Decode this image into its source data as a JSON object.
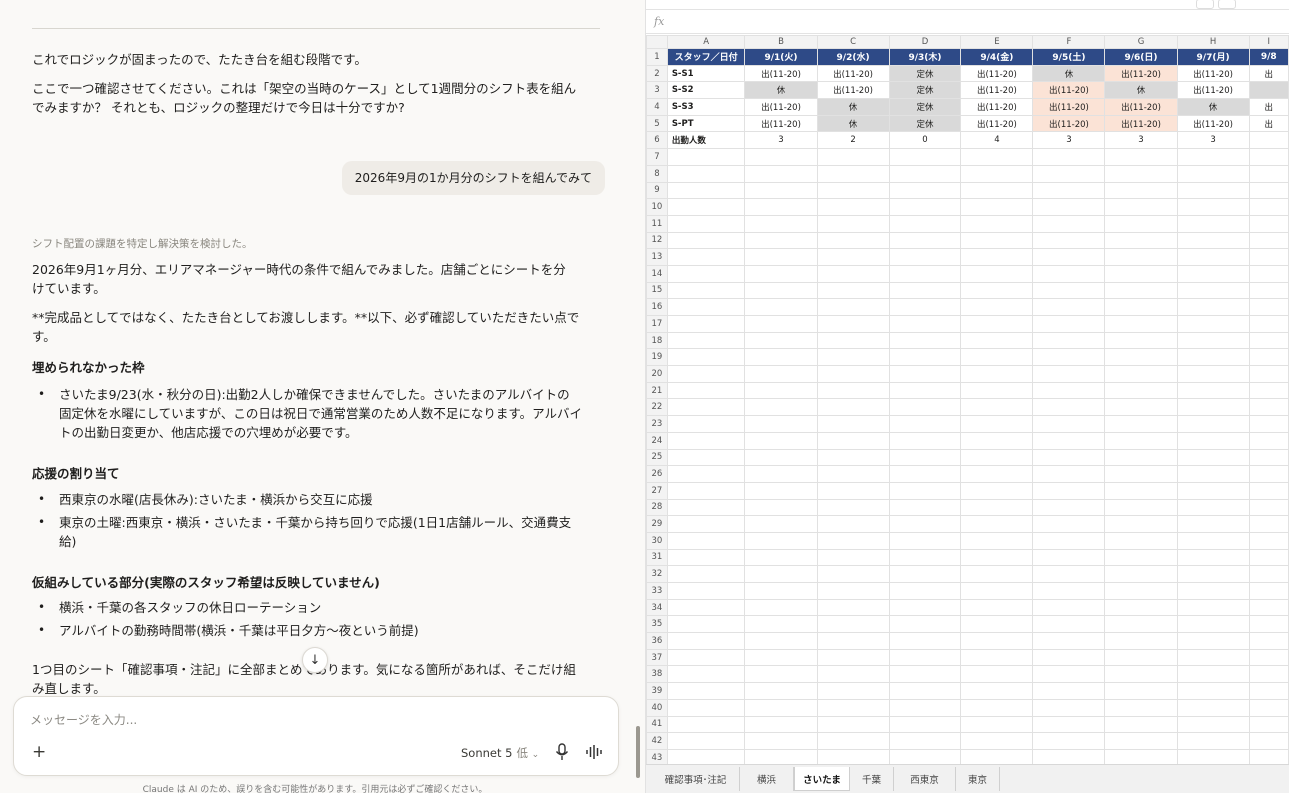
{
  "chat": {
    "assistant_intro_1": "これでロジックが固まったので、たたき台を組む段階です。",
    "assistant_intro_2": "ここで一つ確認させてください。これは「架空の当時のケース」として1週間分のシフト表を組んでみますか？ それとも、ロジックの整理だけで今日は十分ですか?",
    "user_message": "2026年9月の1か月分のシフトを組んでみて",
    "thinking_label": "シフト配置の課題を特定し解決策を検討した。",
    "para_1": "2026年9月1ヶ月分、エリアマネージャー時代の条件で組んでみました。店舗ごとにシートを分けています。",
    "para_2": "**完成品としてではなく、たたき台としてお渡しします。**以下、必ず確認していただきたい点です。",
    "section_1_title": "埋められなかった枠",
    "section_1_items": [
      "さいたま9/23(水・秋分の日):出勤2人しか確保できませんでした。さいたまのアルバイトの固定休を水曜にしていますが、この日は祝日で通常営業のため人数不足になります。アルバイトの出勤日変更か、他店応援での穴埋めが必要です。"
    ],
    "section_2_title": "応援の割り当て",
    "section_2_items": [
      "西東京の水曜(店長休み):さいたま・横浜から交互に応援",
      "東京の土曜:西東京・横浜・さいたま・千葉から持ち回りで応援(1日1店舗ルール、交通費支給)"
    ],
    "section_3_title": "仮組みしている部分(実際のスタッフ希望は反映していません)",
    "section_3_items": [
      "横浜・千葉の各スタッフの休日ローテーション",
      "アルバイトの勤務時間帯(横浜・千葉は平日夕方〜夜という前提)"
    ],
    "para_3": "1つ目のシート「確認事項・注記」に全部まとめてあります。気になる箇所があれば、そこだけ組み直します。"
  },
  "composer": {
    "placeholder": "メッセージを入力...",
    "model_name": "Sonnet 5",
    "model_level": "低",
    "disclaimer": "Claude は AI のため、誤りを含む可能性があります。引用元は必ずご確認ください。"
  },
  "sheet": {
    "fx_label": "fx",
    "col_letters": [
      "A",
      "B",
      "C",
      "D",
      "E",
      "F",
      "G",
      "H",
      "I"
    ],
    "header_row": [
      "スタッフ／日付",
      "9/1(火)",
      "9/2(水)",
      "9/3(木)",
      "9/4(金)",
      "9/5(土)",
      "9/6(日)",
      "9/7(月)",
      "9/8"
    ],
    "rows": [
      {
        "name": "S-S1",
        "cells": [
          {
            "v": "出(11-20)",
            "c": ""
          },
          {
            "v": "出(11-20)",
            "c": ""
          },
          {
            "v": "定休",
            "c": "gray"
          },
          {
            "v": "出(11-20)",
            "c": ""
          },
          {
            "v": "休",
            "c": "gray"
          },
          {
            "v": "出(11-20)",
            "c": "pink"
          },
          {
            "v": "出(11-20)",
            "c": ""
          },
          {
            "v": "出",
            "c": ""
          }
        ]
      },
      {
        "name": "S-S2",
        "cells": [
          {
            "v": "休",
            "c": "gray"
          },
          {
            "v": "出(11-20)",
            "c": ""
          },
          {
            "v": "定休",
            "c": "gray"
          },
          {
            "v": "出(11-20)",
            "c": ""
          },
          {
            "v": "出(11-20)",
            "c": "pink"
          },
          {
            "v": "休",
            "c": "gray"
          },
          {
            "v": "出(11-20)",
            "c": ""
          },
          {
            "v": "",
            "c": "gray"
          }
        ]
      },
      {
        "name": "S-S3",
        "cells": [
          {
            "v": "出(11-20)",
            "c": ""
          },
          {
            "v": "休",
            "c": "gray"
          },
          {
            "v": "定休",
            "c": "gray"
          },
          {
            "v": "出(11-20)",
            "c": ""
          },
          {
            "v": "出(11-20)",
            "c": "pink"
          },
          {
            "v": "出(11-20)",
            "c": "pink"
          },
          {
            "v": "休",
            "c": "gray"
          },
          {
            "v": "出",
            "c": ""
          }
        ]
      },
      {
        "name": "S-PT",
        "cells": [
          {
            "v": "出(11-20)",
            "c": ""
          },
          {
            "v": "休",
            "c": "gray"
          },
          {
            "v": "定休",
            "c": "gray"
          },
          {
            "v": "出(11-20)",
            "c": ""
          },
          {
            "v": "出(11-20)",
            "c": "pink"
          },
          {
            "v": "出(11-20)",
            "c": "pink"
          },
          {
            "v": "出(11-20)",
            "c": ""
          },
          {
            "v": "出",
            "c": ""
          }
        ]
      }
    ],
    "count_row": {
      "label": "出勤人数",
      "values": [
        "3",
        "2",
        "0",
        "4",
        "3",
        "3",
        "3",
        ""
      ]
    },
    "total_rows": 43,
    "tabs": [
      {
        "label": "確認事項･注記",
        "active": false
      },
      {
        "label": "横浜",
        "active": false
      },
      {
        "label": "さいたま",
        "active": true
      },
      {
        "label": "千葉",
        "active": false
      },
      {
        "label": "西東京",
        "active": false
      },
      {
        "label": "東京",
        "active": false
      }
    ],
    "colors": {
      "header_fill": "#2e4a87",
      "gray_fill": "#d9d9d9",
      "pink_fill": "#fbe3d6"
    }
  }
}
